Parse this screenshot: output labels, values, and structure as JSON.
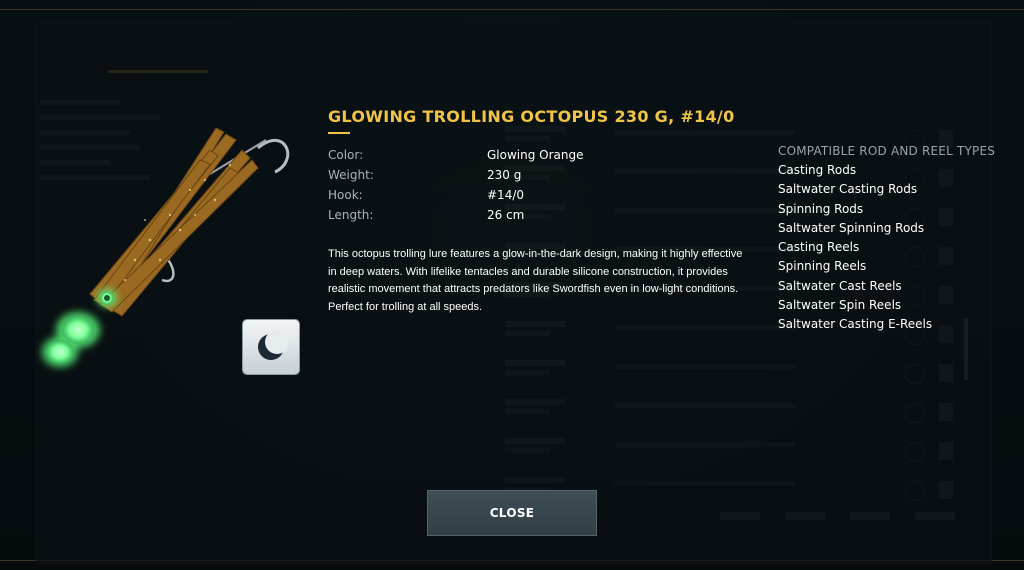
{
  "dialog": {
    "title": "GLOWING TROLLING OCTOPUS 230 G, #14/0",
    "properties": [
      {
        "label": "Color:",
        "value": "Glowing Orange"
      },
      {
        "label": "Weight:",
        "value": "230 g"
      },
      {
        "label": "Hook:",
        "value": "#14/0"
      },
      {
        "label": "Length:",
        "value": "26 cm"
      }
    ],
    "description": "This octopus trolling lure features a glow-in-the-dark design, making it highly effective in deep waters. With lifelike tentacles and durable silicone construction, it provides realistic movement that attracts predators like Swordfish even in low-light conditions. Perfect for trolling at all speeds.",
    "compatible": {
      "heading": "COMPATIBLE ROD AND REEL TYPES",
      "items": [
        "Casting Rods",
        "Saltwater Casting Rods",
        "Spinning Rods",
        "Saltwater Spinning Rods",
        "Casting Reels",
        "Spinning Reels",
        "Saltwater Cast Reels",
        "Saltwater Spin Reels",
        "Saltwater Casting E-Reels"
      ]
    },
    "close_label": "CLOSE",
    "night_mode_icon": "moon-icon",
    "item_icon": "octopus-lure-icon"
  },
  "colors": {
    "title": "#f0c547",
    "label": "#aab3b7",
    "value": "#ffffff",
    "glow": "#7dff9a",
    "lure_body": "#9a6a22"
  }
}
